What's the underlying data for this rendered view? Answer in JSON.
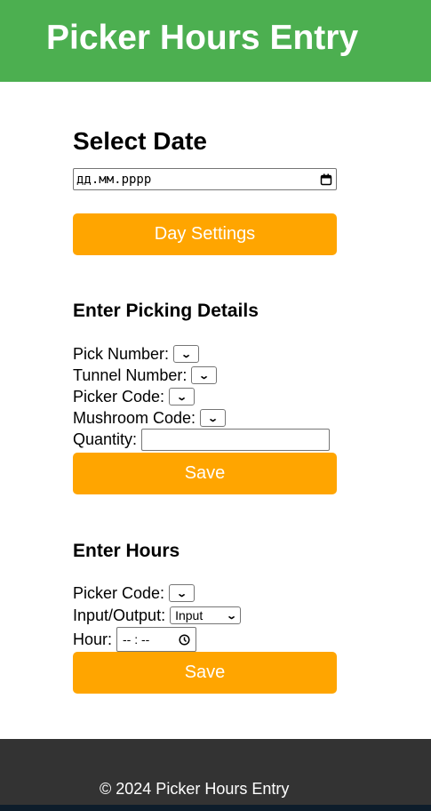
{
  "header": {
    "title": "Picker Hours Entry"
  },
  "date_section": {
    "heading": "Select Date",
    "date_placeholder": "дд.мм.рррр",
    "day_settings_label": "Day Settings"
  },
  "picking": {
    "heading": "Enter Picking Details",
    "pick_number_label": "Pick Number:",
    "tunnel_number_label": "Tunnel Number:",
    "picker_code_label": "Picker Code:",
    "mushroom_code_label": "Mushroom Code:",
    "quantity_label": "Quantity:",
    "quantity_value": "",
    "save_label": "Save"
  },
  "hours": {
    "heading": "Enter Hours",
    "picker_code_label": "Picker Code:",
    "io_label": "Input/Output:",
    "io_selected": "Input",
    "hour_label": "Hour:",
    "hour_placeholder": "-- : --",
    "save_label": "Save"
  },
  "footer": {
    "text": "© 2024 Picker Hours Entry"
  },
  "colors": {
    "header": "#4caf50",
    "button": "#ffa500",
    "footer": "#333333"
  }
}
